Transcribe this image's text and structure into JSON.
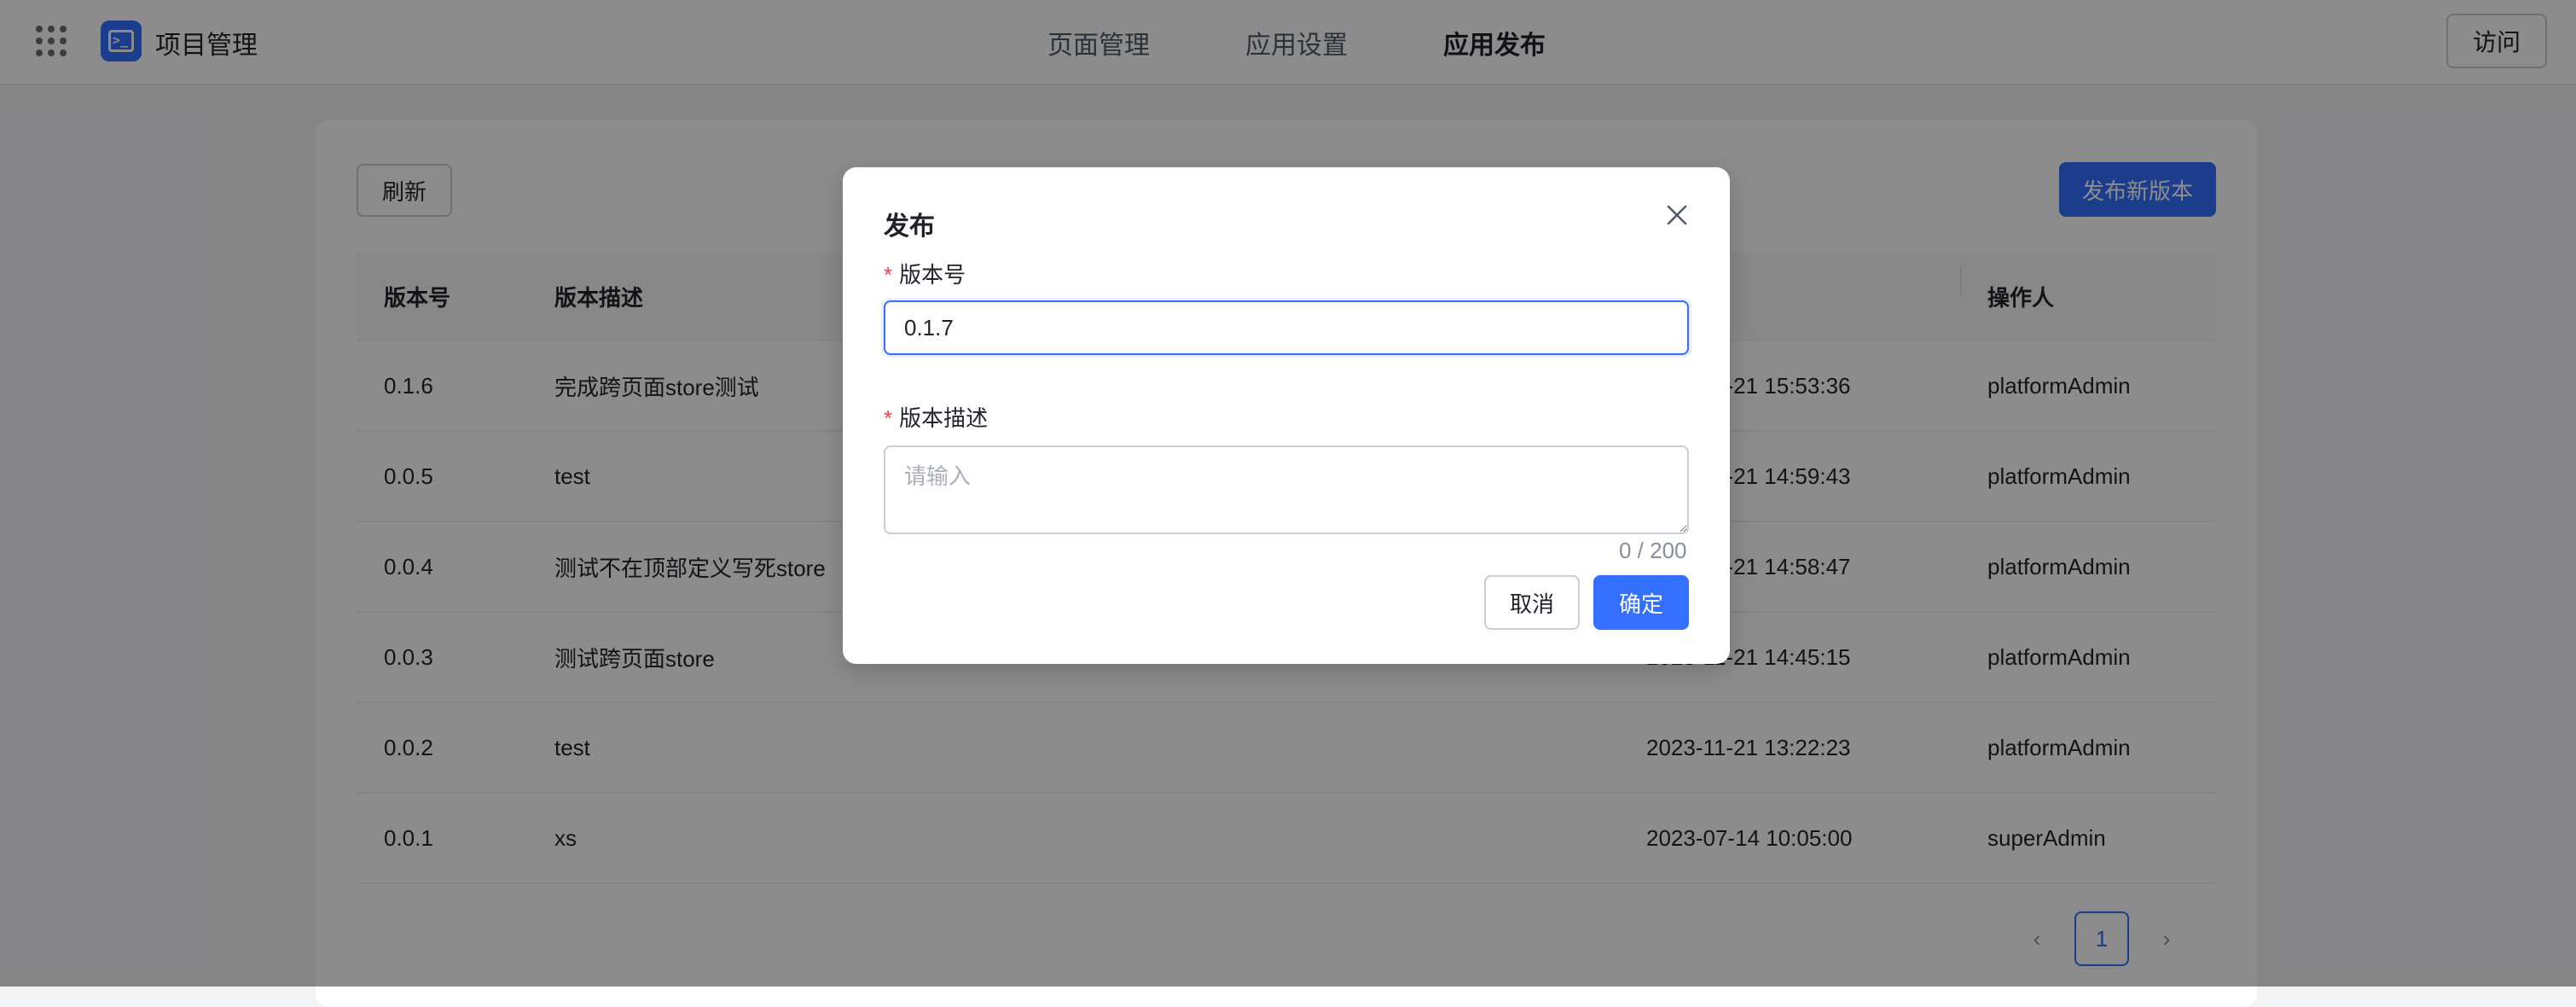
{
  "header": {
    "app_title": "项目管理",
    "nav": [
      "页面管理",
      "应用设置",
      "应用发布"
    ],
    "active_nav": "应用发布",
    "visit_label": "访问"
  },
  "toolbar": {
    "refresh_label": "刷新",
    "publish_label": "发布新版本"
  },
  "table": {
    "columns": [
      "版本号",
      "版本描述",
      "",
      "操作人"
    ],
    "rows": [
      {
        "version": "0.1.6",
        "desc": "完成跨页面store测试",
        "time": "2023-11-21 15:53:36",
        "operator": "platformAdmin"
      },
      {
        "version": "0.0.5",
        "desc": "test",
        "time": "2023-11-21 14:59:43",
        "operator": "platformAdmin"
      },
      {
        "version": "0.0.4",
        "desc": "测试不在顶部定义写死store",
        "time": "2023-11-21 14:58:47",
        "operator": "platformAdmin"
      },
      {
        "version": "0.0.3",
        "desc": "测试跨页面store",
        "time": "2023-11-21 14:45:15",
        "operator": "platformAdmin"
      },
      {
        "version": "0.0.2",
        "desc": "test",
        "time": "2023-11-21 13:22:23",
        "operator": "platformAdmin"
      },
      {
        "version": "0.0.1",
        "desc": "xs",
        "time": "2023-07-14 10:05:00",
        "operator": "superAdmin"
      }
    ]
  },
  "pagination": {
    "prev": "‹",
    "current_page": "1",
    "next": "›"
  },
  "modal": {
    "title": "发布",
    "version_label": "版本号",
    "version_value": "0.1.7",
    "desc_label": "版本描述",
    "desc_placeholder": "请输入",
    "desc_counter": "0 / 200",
    "required_mark": "*",
    "cancel_label": "取消",
    "ok_label": "确定"
  },
  "colors": {
    "primary": "#3370ff",
    "required": "#f53f3f",
    "mask": "rgba(0,0,0,0.45)"
  }
}
